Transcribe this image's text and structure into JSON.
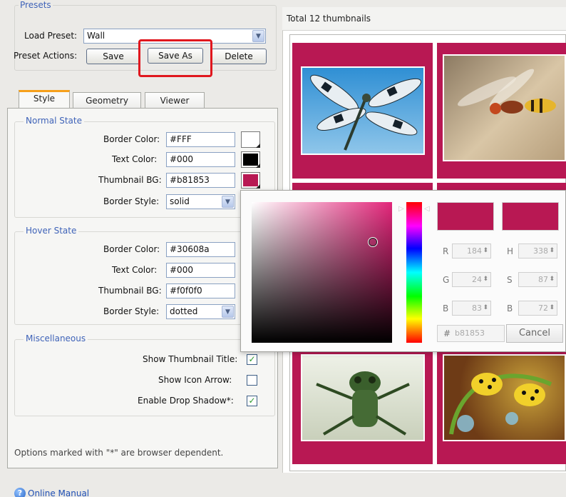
{
  "presets": {
    "legend": "Presets",
    "load_label": "Load Preset:",
    "load_value": "Wall",
    "actions_label": "Preset Actions:",
    "save": "Save",
    "save_as": "Save As",
    "delete": "Delete"
  },
  "tabs": [
    {
      "label": "Style",
      "active": true
    },
    {
      "label": "Geometry",
      "active": false
    },
    {
      "label": "Viewer",
      "active": false
    }
  ],
  "normal_state": {
    "legend": "Normal State",
    "border_color_label": "Border Color:",
    "border_color": "#FFF",
    "border_swatch": "#ffffff",
    "text_color_label": "Text Color:",
    "text_color": "#000",
    "text_swatch": "#000000",
    "thumb_bg_label": "Thumbnail BG:",
    "thumb_bg": "#b81853",
    "thumb_swatch": "#b81853",
    "border_style_label": "Border Style:",
    "border_style": "solid"
  },
  "hover_state": {
    "legend": "Hover State",
    "border_color_label": "Border Color:",
    "border_color": "#30608a",
    "text_color_label": "Text Color:",
    "text_color": "#000",
    "thumb_bg_label": "Thumbnail BG:",
    "thumb_bg": "#f0f0f0",
    "border_style_label": "Border Style:",
    "border_style": "dotted"
  },
  "misc": {
    "legend": "Miscellaneous",
    "show_title_label": "Show Thumbnail Title:",
    "show_title": true,
    "show_arrow_label": "Show Icon Arrow:",
    "show_arrow": false,
    "drop_shadow_label": "Enable Drop Shadow*:",
    "drop_shadow": true
  },
  "note": "Options marked with \"*\" are browser dependent.",
  "footer": {
    "manual_link": "Online Manual"
  },
  "gallery": {
    "header": "Total 12 thumbnails",
    "thumb_color": "#b81853"
  },
  "picker": {
    "current_color": "#b81853",
    "r_label": "R",
    "r": "184",
    "g_label": "G",
    "g": "24",
    "b_label": "B",
    "b": "83",
    "h_label": "H",
    "h": "338",
    "s_label": "S",
    "s": "87",
    "v_label": "B",
    "v": "72",
    "hex_label": "#",
    "hex": "b81853",
    "cancel": "Cancel"
  }
}
